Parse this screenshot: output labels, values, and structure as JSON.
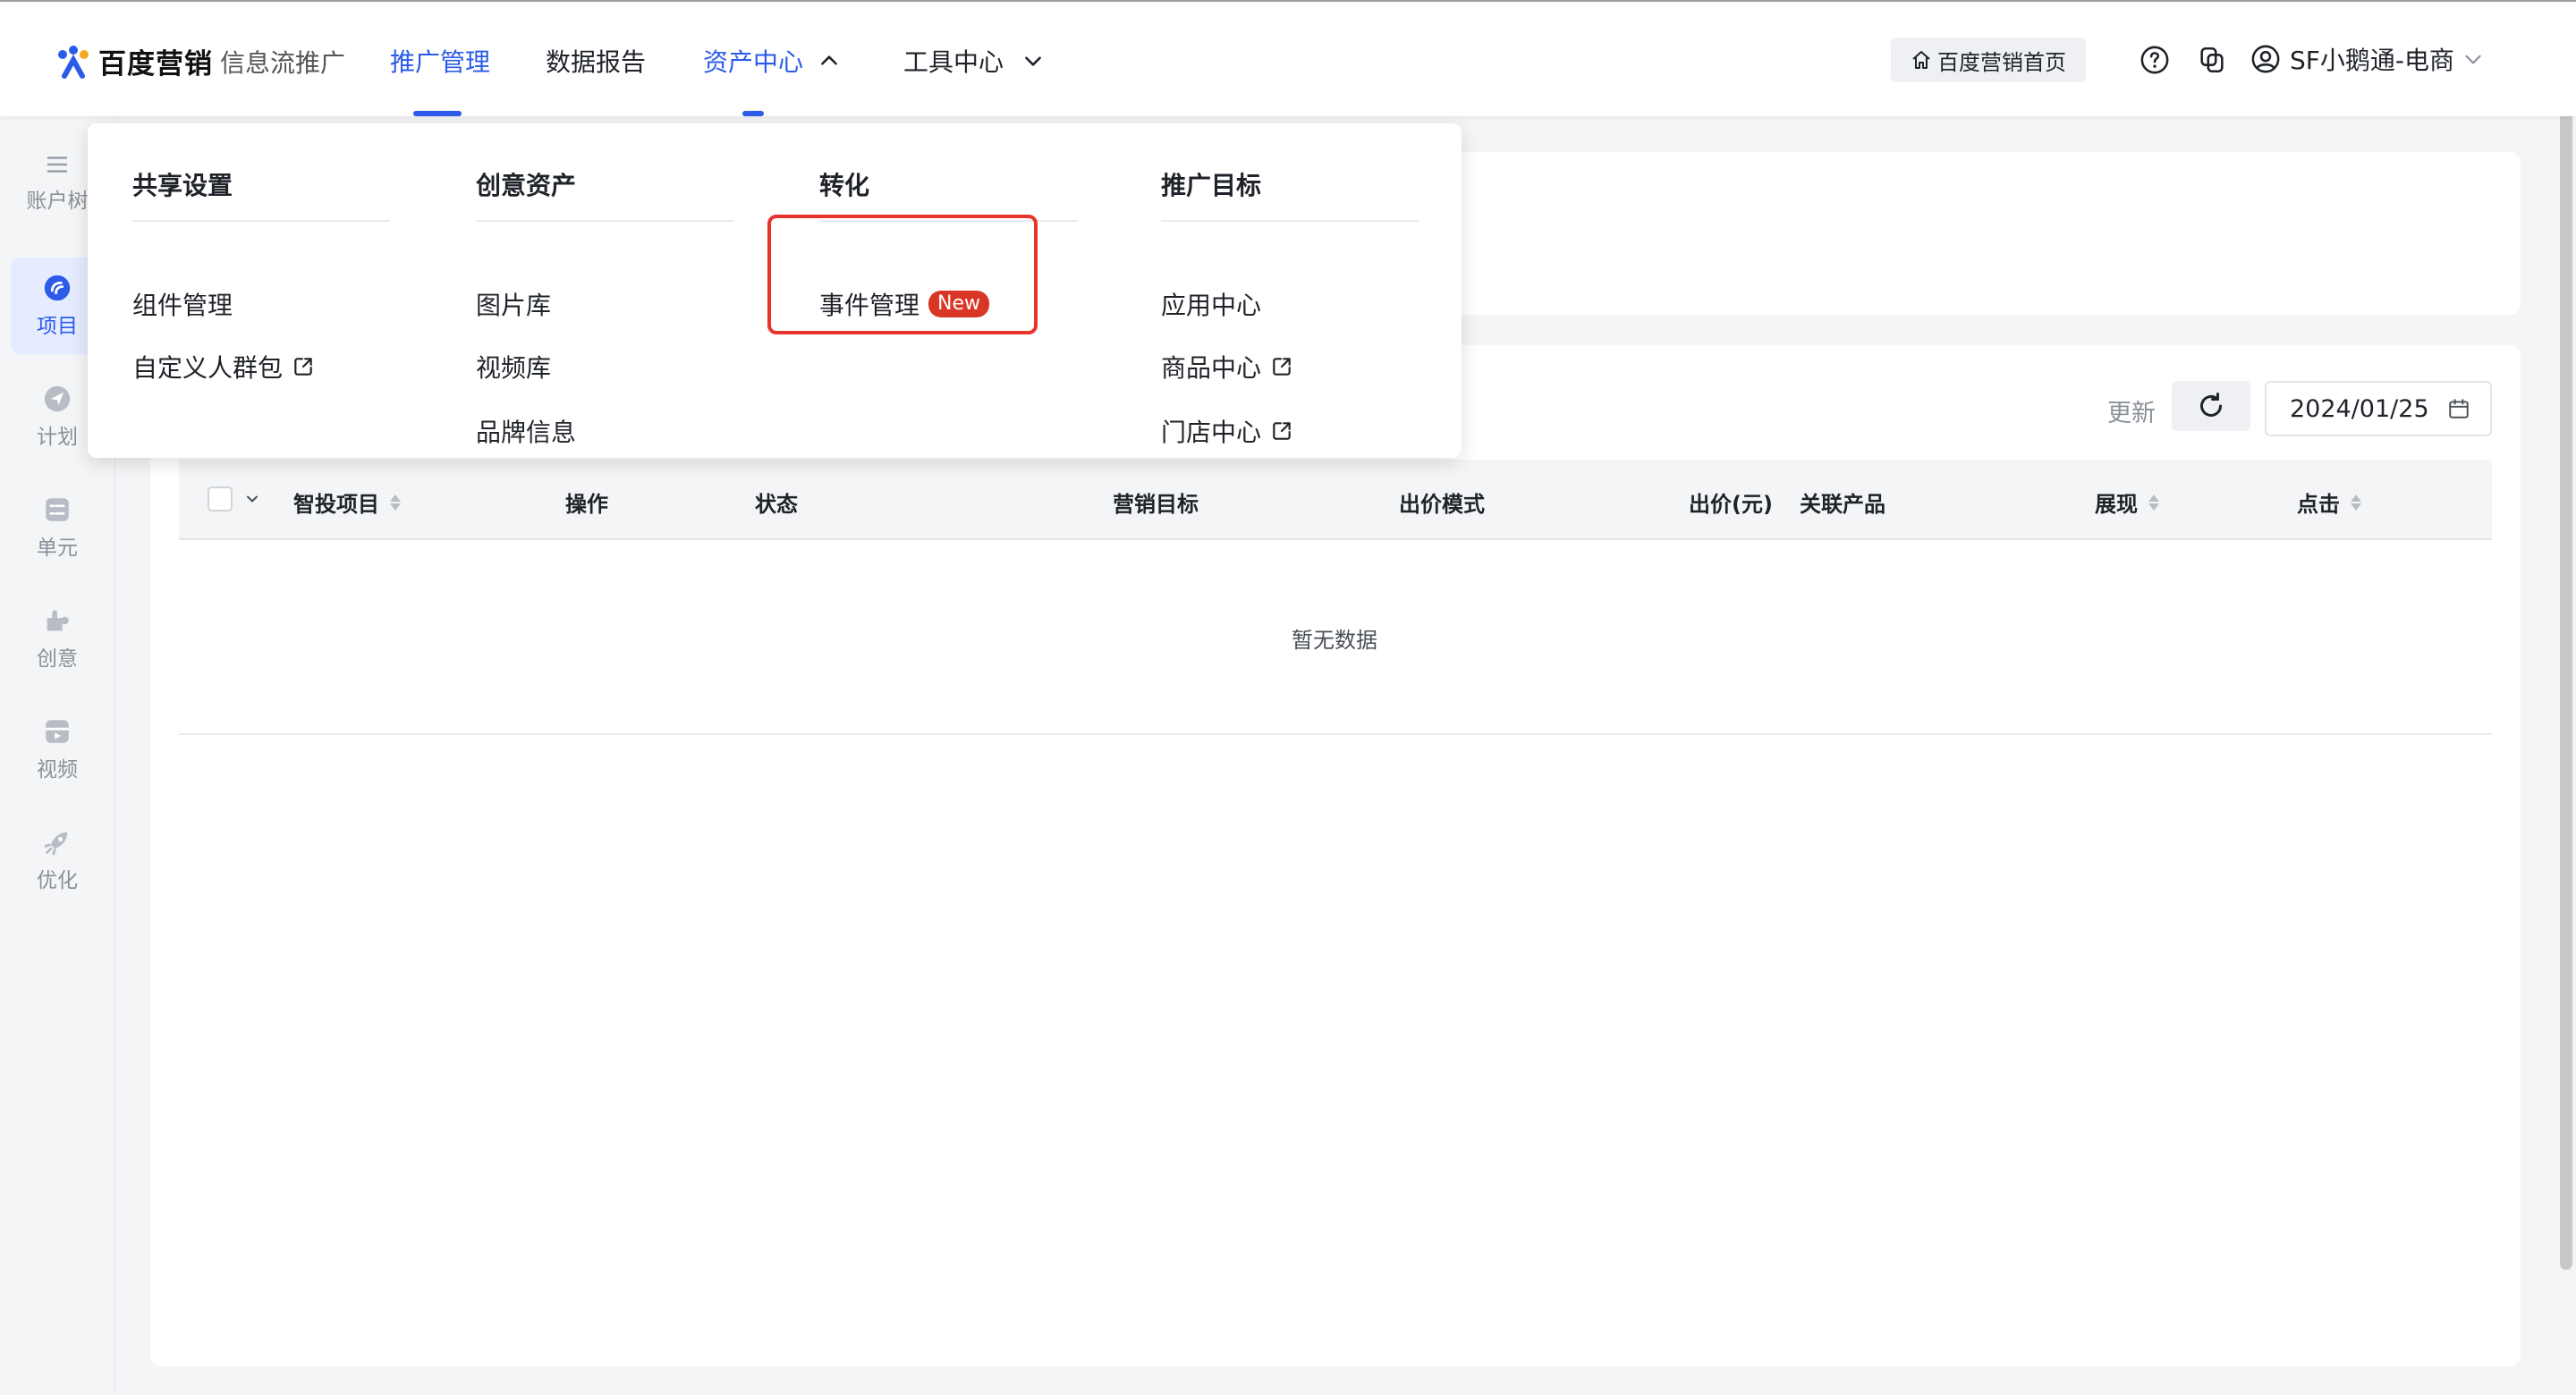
{
  "header": {
    "brand": "百度营销",
    "product": "信息流推广",
    "nav": [
      {
        "label": "推广管理",
        "active": true
      },
      {
        "label": "数据报告",
        "active": false
      },
      {
        "label": "资产中心",
        "active": true,
        "expanded": true
      },
      {
        "label": "工具中心",
        "active": false
      }
    ],
    "home_button": "百度营销首页",
    "user_name": "SF小鹅通-电商"
  },
  "sidebar": {
    "items": [
      {
        "label": "账户树",
        "icon": "menu-icon"
      },
      {
        "label": "项目",
        "icon": "project-icon",
        "active": true
      },
      {
        "label": "计划",
        "icon": "plan-icon"
      },
      {
        "label": "单元",
        "icon": "unit-icon"
      },
      {
        "label": "创意",
        "icon": "creative-icon"
      },
      {
        "label": "视频",
        "icon": "video-icon"
      },
      {
        "label": "优化",
        "icon": "rocket-icon"
      }
    ]
  },
  "dropdown": {
    "columns": [
      {
        "title": "共享设置",
        "items": [
          {
            "label": "组件管理"
          },
          {
            "label": "自定义人群包",
            "external": true
          }
        ]
      },
      {
        "title": "创意资产",
        "items": [
          {
            "label": "图片库"
          },
          {
            "label": "视频库"
          },
          {
            "label": "品牌信息"
          }
        ]
      },
      {
        "title": "转化",
        "items": [
          {
            "label": "事件管理",
            "badge": "New"
          }
        ]
      },
      {
        "title": "推广目标",
        "items": [
          {
            "label": "应用中心"
          },
          {
            "label": "商品中心",
            "external": true
          },
          {
            "label": "门店中心",
            "external": true
          }
        ]
      }
    ]
  },
  "toolbar": {
    "refresh_label": "更新",
    "date": "2024/01/25"
  },
  "table": {
    "columns": [
      "智投项目",
      "操作",
      "状态",
      "营销目标",
      "出价模式",
      "出价(元)",
      "关联产品",
      "展现",
      "点击"
    ],
    "empty_text": "暂无数据"
  },
  "colors": {
    "accent": "#2b5be8",
    "badge": "#d93626",
    "highlight": "#e8352b"
  }
}
